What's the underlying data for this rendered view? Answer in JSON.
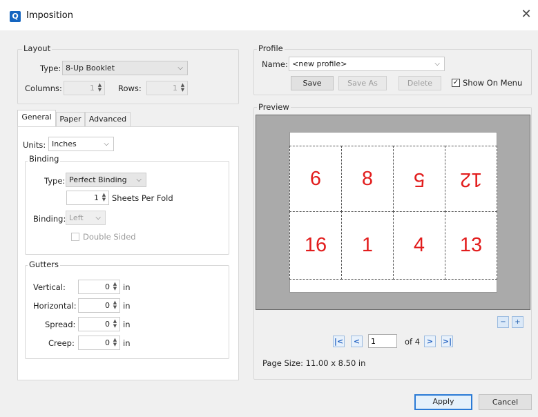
{
  "window": {
    "title": "Imposition",
    "app_icon": "Q"
  },
  "layout": {
    "legend": "Layout",
    "type_label": "Type:",
    "type_value": "8-Up Booklet",
    "columns_label": "Columns:",
    "columns_value": "1",
    "rows_label": "Rows:",
    "rows_value": "1"
  },
  "tabs": [
    "General",
    "Paper",
    "Advanced"
  ],
  "general": {
    "units_label": "Units:",
    "units_value": "Inches",
    "binding_legend": "Binding",
    "binding_type_label": "Type:",
    "binding_type_value": "Perfect Binding",
    "sheets_per_fold_value": "1",
    "sheets_per_fold_label": "Sheets Per Fold",
    "binding_label": "Binding:",
    "binding_value": "Left",
    "double_sided_label": "Double Sided",
    "gutters_legend": "Gutters",
    "gutters": [
      {
        "label": "Vertical:",
        "value": "0",
        "unit": "in"
      },
      {
        "label": "Horizontal:",
        "value": "0",
        "unit": "in"
      },
      {
        "label": "Spread:",
        "value": "0",
        "unit": "in"
      },
      {
        "label": "Creep:",
        "value": "0",
        "unit": "in"
      }
    ]
  },
  "profile": {
    "legend": "Profile",
    "name_label": "Name:",
    "name_value": "<new profile>",
    "save": "Save",
    "save_as": "Save As",
    "delete": "Delete",
    "show_on_menu": "Show On Menu",
    "show_on_menu_checked": true
  },
  "preview": {
    "legend": "Preview",
    "top_row": [
      {
        "n": "6",
        "flipped": false
      },
      {
        "n": "8",
        "flipped": false
      },
      {
        "n": "5",
        "flipped": true
      },
      {
        "n": "12",
        "flipped": true
      }
    ],
    "bottom_row": [
      {
        "n": "16",
        "flipped": false
      },
      {
        "n": "1",
        "flipped": false
      },
      {
        "n": "4",
        "flipped": false
      },
      {
        "n": "13",
        "flipped": false
      }
    ],
    "page_input": "1",
    "of_text": "of 4",
    "page_size_text": "Page Size: 11.00 x 8.50 in",
    "bg_color": "#aaaaaa",
    "number_color": "#e21d1d"
  },
  "footer": {
    "apply": "Apply",
    "cancel": "Cancel"
  }
}
